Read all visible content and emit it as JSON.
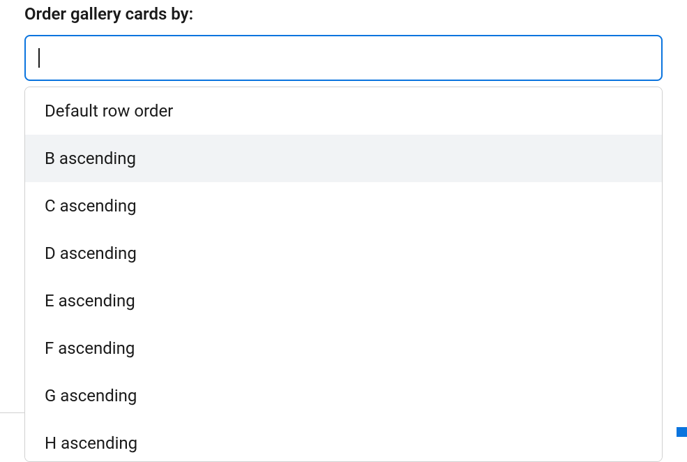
{
  "label": "Order gallery cards by:",
  "input": {
    "value": "",
    "placeholder": ""
  },
  "dropdown": {
    "highlighted_index": 1,
    "options": [
      "Default row order",
      "B ascending",
      "C ascending",
      "D ascending",
      "E ascending",
      "F ascending",
      "G ascending",
      "H ascending"
    ]
  },
  "colors": {
    "accent": "#0b74de",
    "highlight": "#f1f3f5"
  }
}
